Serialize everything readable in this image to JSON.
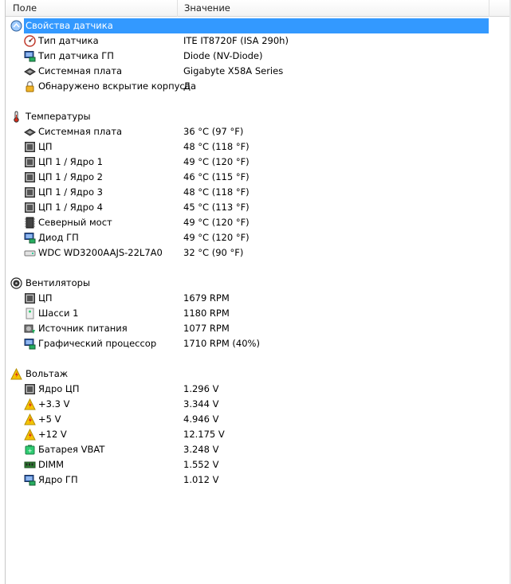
{
  "header": {
    "field": "Поле",
    "value": "Значение"
  },
  "rows": [
    {
      "type": "section",
      "label": "Свойства датчика",
      "icon": "sensor-icon",
      "selected": true
    },
    {
      "type": "item",
      "label": "Тип датчика",
      "value": "ITE IT8720F  (ISA 290h)",
      "icon": "gauge-icon"
    },
    {
      "type": "item",
      "label": "Тип датчика ГП",
      "value": "Diode  (NV-Diode)",
      "icon": "gpu-monitor-icon"
    },
    {
      "type": "item",
      "label": "Системная плата",
      "value": "Gigabyte X58A Series",
      "icon": "motherboard-icon"
    },
    {
      "type": "item",
      "label": "Обнаружено вскрытие корпуса",
      "value": "Да",
      "icon": "lock-icon"
    },
    {
      "type": "spacer"
    },
    {
      "type": "section",
      "label": "Температуры",
      "icon": "thermometer-icon"
    },
    {
      "type": "item",
      "label": "Системная плата",
      "value": "36 °C  (97 °F)",
      "icon": "motherboard-icon"
    },
    {
      "type": "item",
      "label": "ЦП",
      "value": "48 °C  (118 °F)",
      "icon": "cpu-icon"
    },
    {
      "type": "item",
      "label": "ЦП 1 / Ядро 1",
      "value": "49 °C  (120 °F)",
      "icon": "cpu-icon"
    },
    {
      "type": "item",
      "label": "ЦП 1 / Ядро 2",
      "value": "46 °C  (115 °F)",
      "icon": "cpu-icon"
    },
    {
      "type": "item",
      "label": "ЦП 1 / Ядро 3",
      "value": "48 °C  (118 °F)",
      "icon": "cpu-icon"
    },
    {
      "type": "item",
      "label": "ЦП 1 / Ядро 4",
      "value": "45 °C  (113 °F)",
      "icon": "cpu-icon"
    },
    {
      "type": "item",
      "label": "Северный мост",
      "value": "49 °C  (120 °F)",
      "icon": "northbridge-chip-icon"
    },
    {
      "type": "item",
      "label": "Диод ГП",
      "value": "49 °C  (120 °F)",
      "icon": "gpu-monitor-icon"
    },
    {
      "type": "item",
      "label": "WDC WD3200AAJS-22L7A0",
      "value": "32 °C  (90 °F)",
      "icon": "hard-drive-icon"
    },
    {
      "type": "spacer"
    },
    {
      "type": "section",
      "label": "Вентиляторы",
      "icon": "fan-icon"
    },
    {
      "type": "item",
      "label": "ЦП",
      "value": "1679 RPM",
      "icon": "cpu-icon"
    },
    {
      "type": "item",
      "label": "Шасси 1",
      "value": "1180 RPM",
      "icon": "chassis-icon"
    },
    {
      "type": "item",
      "label": "Источник питания",
      "value": "1077 RPM",
      "icon": "power-supply-icon"
    },
    {
      "type": "item",
      "label": "Графический процессор",
      "value": "1710 RPM  (40%)",
      "icon": "gpu-monitor-icon"
    },
    {
      "type": "spacer"
    },
    {
      "type": "section",
      "label": "Вольтаж",
      "icon": "voltage-warning-icon"
    },
    {
      "type": "item",
      "label": "Ядро ЦП",
      "value": "1.296 V",
      "icon": "cpu-icon"
    },
    {
      "type": "item",
      "label": "+3.3 V",
      "value": "3.344 V",
      "icon": "voltage-warning-icon"
    },
    {
      "type": "item",
      "label": "+5 V",
      "value": "4.946 V",
      "icon": "voltage-warning-icon"
    },
    {
      "type": "item",
      "label": "+12 V",
      "value": "12.175 V",
      "icon": "voltage-warning-icon"
    },
    {
      "type": "item",
      "label": "Батарея VBAT",
      "value": "3.248 V",
      "icon": "battery-icon"
    },
    {
      "type": "item",
      "label": "DIMM",
      "value": "1.552 V",
      "icon": "memory-module-icon"
    },
    {
      "type": "item",
      "label": "Ядро ГП",
      "value": "1.012 V",
      "icon": "gpu-monitor-icon"
    }
  ],
  "colors": {
    "selection": "#3399ff",
    "selection_text": "#ffffff"
  }
}
